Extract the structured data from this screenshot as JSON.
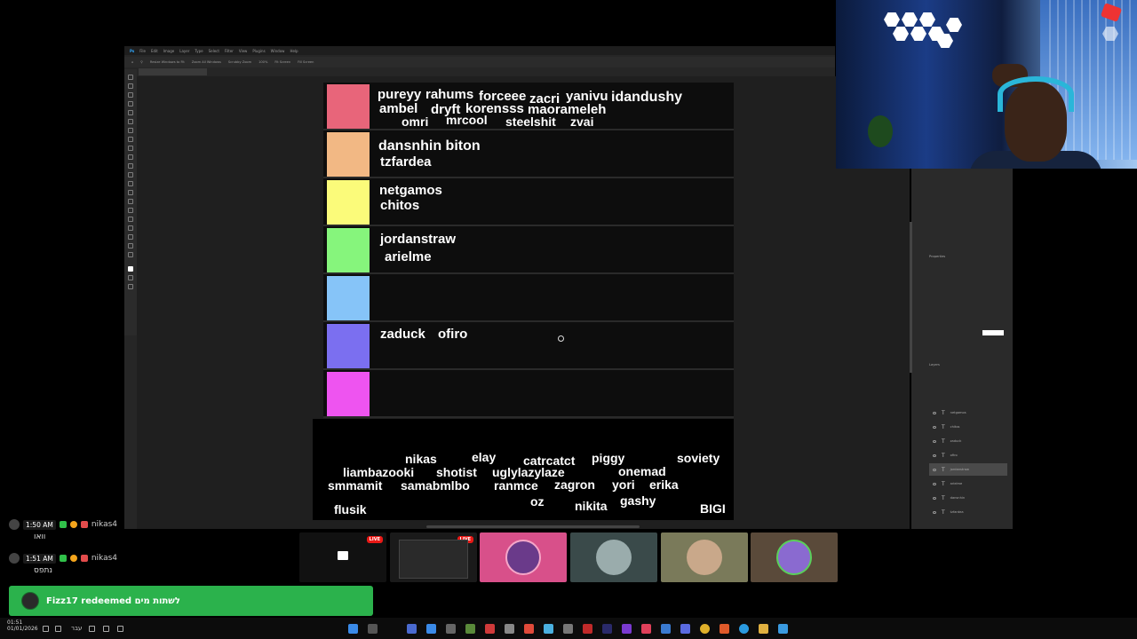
{
  "photoshop": {
    "menu": [
      "File",
      "Edit",
      "Image",
      "Layer",
      "Type",
      "Select",
      "Filter",
      "View",
      "Plugins",
      "Window",
      "Help"
    ],
    "options": [
      "Resize Windows to Fit",
      "Zoom All Windows",
      "Scrubby Zoom",
      "100%",
      "Fit Screen",
      "Fill Screen"
    ],
    "doc_tab": "Untitled-1 @ 100% (chitos, RGB/8) *",
    "layers": [
      "netgamos",
      "chitos",
      "zaduck",
      "ofiro",
      "jordanstraw",
      "arielme",
      "dansnhin",
      "tzfardea"
    ]
  },
  "tier_list": {
    "tiers": [
      {
        "color": "#e8657a",
        "names": [
          {
            "text": "pureyy"
          },
          {
            "text": "rahums"
          },
          {
            "text": "forceee"
          },
          {
            "text": "zacri"
          },
          {
            "text": "yanivu"
          },
          {
            "text": "idandushy"
          },
          {
            "text": "ambel"
          },
          {
            "text": "dryft"
          },
          {
            "text": "korensss"
          },
          {
            "text": "maorameleh"
          },
          {
            "text": "omri"
          },
          {
            "text": "mrcool"
          },
          {
            "text": "steelshit"
          },
          {
            "text": "zvai"
          }
        ]
      },
      {
        "color": "#f2b884",
        "names": [
          {
            "text": "dansnhin biton"
          },
          {
            "text": "tzfardea"
          }
        ]
      },
      {
        "color": "#fbfb7a",
        "names": [
          {
            "text": "netgamos"
          },
          {
            "text": "chitos"
          }
        ]
      },
      {
        "color": "#86f57c",
        "names": [
          {
            "text": "jordanstraw"
          },
          {
            "text": "arielme"
          }
        ]
      },
      {
        "color": "#86c4f8",
        "names": []
      },
      {
        "color": "#7b6ff0",
        "names": [
          {
            "text": "zaduck"
          },
          {
            "text": "ofiro"
          }
        ]
      },
      {
        "color": "#ee54f0",
        "names": []
      }
    ],
    "unranked": [
      {
        "text": "nikas"
      },
      {
        "text": "elay"
      },
      {
        "text": "catrcatct"
      },
      {
        "text": "piggy"
      },
      {
        "text": "soviety"
      },
      {
        "text": "liambazooki"
      },
      {
        "text": "shotist"
      },
      {
        "text": "uglylazylaze"
      },
      {
        "text": "onemad"
      },
      {
        "text": "smmamit"
      },
      {
        "text": "samabmlbo"
      },
      {
        "text": "ranmce"
      },
      {
        "text": "zagron"
      },
      {
        "text": "yori"
      },
      {
        "text": "erika"
      },
      {
        "text": "flusik"
      },
      {
        "text": "oz"
      },
      {
        "text": "nikita"
      },
      {
        "text": "gashy"
      },
      {
        "text": "BIGI"
      }
    ]
  },
  "chat": [
    {
      "time": "1:50 AM",
      "user": "nikas4",
      "message": "וואו"
    },
    {
      "time": "1:51 AM",
      "user": "nikas4",
      "message": "נתפס"
    }
  ],
  "redemption": {
    "text": "Fizz17 redeemed לשתות מים"
  },
  "thumbnails": [
    {
      "live": "LIVE",
      "color": "#111111"
    },
    {
      "live": "LIVE",
      "color": "#1a1a1a"
    },
    {
      "live": "",
      "color": "#d8508a"
    },
    {
      "live": "",
      "color": "#3a4a4a"
    },
    {
      "live": "",
      "color": "#7a7a5a"
    },
    {
      "live": "",
      "color": "#5a4a3a"
    }
  ],
  "taskbar": {
    "time": "01:51",
    "date": "01/01/2026",
    "language": "עבר"
  }
}
